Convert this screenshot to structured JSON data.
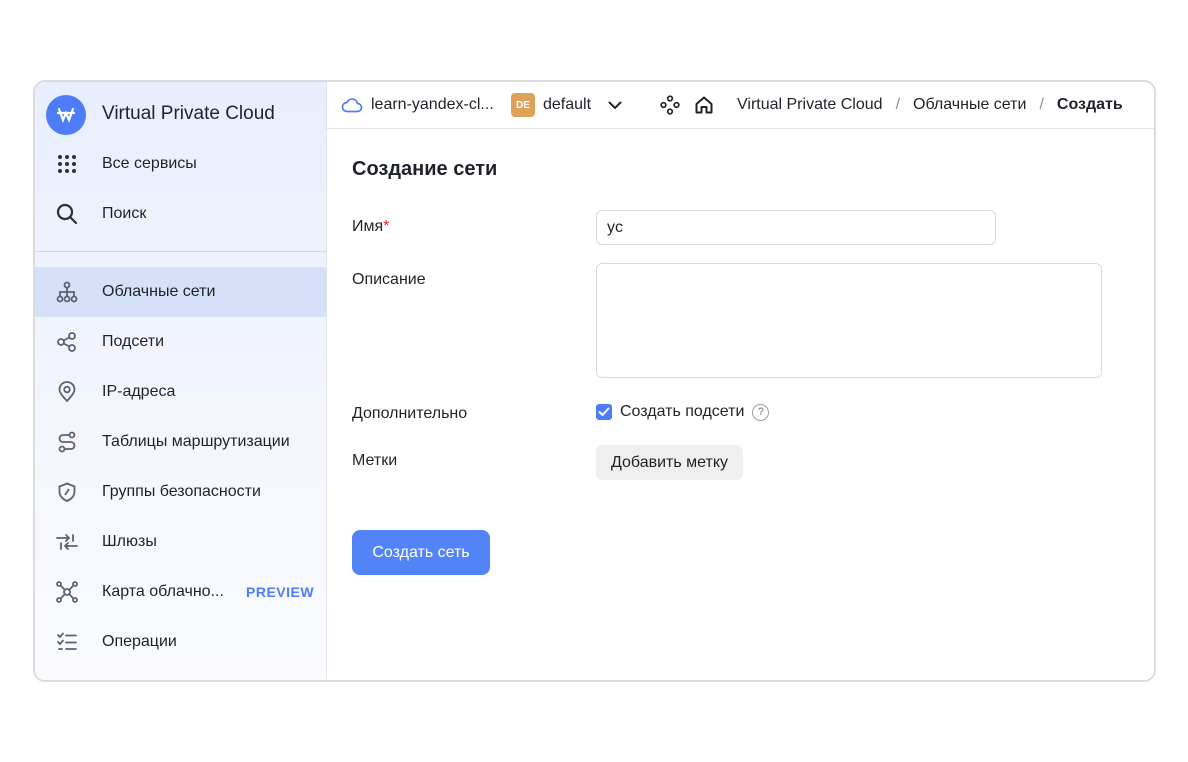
{
  "sidebar": {
    "brand_title": "Virtual Private Cloud",
    "top_items": [
      {
        "label": "Все сервисы",
        "icon": "grid-icon"
      },
      {
        "label": "Поиск",
        "icon": "search-icon"
      }
    ],
    "items": [
      {
        "label": "Облачные сети",
        "icon": "network-icon",
        "active": true
      },
      {
        "label": "Подсети",
        "icon": "subnets-icon"
      },
      {
        "label": "IP-адреса",
        "icon": "location-pin-icon"
      },
      {
        "label": "Таблицы маршрутизации",
        "icon": "route-icon"
      },
      {
        "label": "Группы безопасности",
        "icon": "shield-icon"
      },
      {
        "label": "Шлюзы",
        "icon": "gateway-arrows-icon"
      },
      {
        "label": "Карта облачно...",
        "icon": "map-nodes-icon",
        "badge": "PREVIEW"
      },
      {
        "label": "Операции",
        "icon": "list-check-icon"
      }
    ]
  },
  "header": {
    "cloud_name": "learn-yandex-cl...",
    "folder_badge": "DE",
    "folder_name": "default",
    "breadcrumbs": [
      "Virtual Private Cloud",
      "Облачные сети",
      "Создать"
    ],
    "separator": "/"
  },
  "form": {
    "title": "Создание сети",
    "name_label": "Имя",
    "required_mark": "*",
    "name_value": "yc",
    "description_label": "Описание",
    "additional_label": "Дополнительно",
    "create_subnets_label": "Создать подсети",
    "create_subnets_checked": true,
    "help_glyph": "?",
    "labels_label": "Метки",
    "add_label_button": "Добавить метку",
    "submit_button": "Создать сеть"
  },
  "colors": {
    "accent": "#4d7cf6",
    "primary_button": "#5283f7",
    "folder_badge": "#dfa25a",
    "required": "#d6322c",
    "active_item_bg": "#d5e0f9"
  }
}
